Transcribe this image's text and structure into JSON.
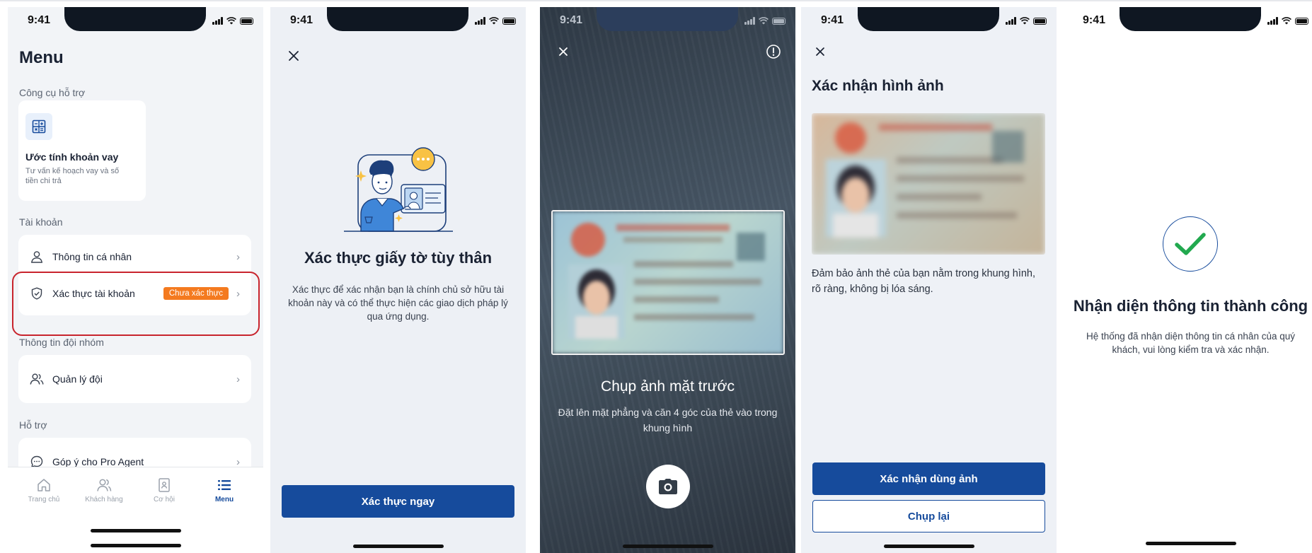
{
  "status_time": "9:41",
  "screen_menu": {
    "title": "Menu",
    "tools_section": "Công cụ hỗ trợ",
    "tool_card": {
      "name": "Ước tính khoản vay",
      "description": "Tư vấn kế hoạch vay và số tiền chi trả",
      "icon": "calculator-icon"
    },
    "account_section": "Tài khoản",
    "account_items": [
      {
        "label": "Thông tin cá nhân",
        "icon": "user-icon"
      },
      {
        "label": "Xác thực tài khoản",
        "icon": "shield-check-icon",
        "badge": "Chưa xác thực"
      }
    ],
    "team_section": "Thông tin đội nhóm",
    "team_items": [
      {
        "label": "Quản lý đội",
        "icon": "users-icon"
      }
    ],
    "support_section": "Hỗ trợ",
    "support_items": [
      {
        "label": "Góp ý cho Pro Agent",
        "icon": "chat-icon"
      }
    ],
    "tabs": [
      {
        "label": "Trang chủ",
        "icon": "home-icon"
      },
      {
        "label": "Khách hàng",
        "icon": "customers-icon"
      },
      {
        "label": "Cơ hội",
        "icon": "opportunity-icon"
      },
      {
        "label": "Menu",
        "icon": "menu-list-icon",
        "active": true
      }
    ],
    "colors": {
      "badge": "#f47a1f",
      "highlight": "#c8242d",
      "active_tab": "#164b9c"
    }
  },
  "screen_verify_intro": {
    "title": "Xác thực giấy tờ tùy thân",
    "description": "Xác thực để xác nhận bạn là chính chủ sở hữu tài khoản này và có thể thực hiện các giao dịch pháp lý qua ứng dụng.",
    "button": "Xác thực ngay"
  },
  "screen_camera": {
    "title": "Chụp ảnh mặt trước",
    "subtitle": "Đặt lên mặt phẳng và căn 4 góc của thẻ vào trong khung hình"
  },
  "screen_confirm_photo": {
    "title": "Xác nhận hình ảnh",
    "description": "Đảm bảo ảnh thẻ của bạn nằm trong khung hình, rõ ràng, không bị lóa sáng.",
    "confirm_button": "Xác nhận dùng ảnh",
    "retake_button": "Chụp lại"
  },
  "screen_success": {
    "title": "Nhận diện thông tin thành công",
    "description": "Hệ thống đã nhận diện thông tin cá nhân của quý khách, vui lòng kiểm tra và xác nhận."
  },
  "colors": {
    "primary": "#164b9c",
    "success": "#22a94f"
  }
}
